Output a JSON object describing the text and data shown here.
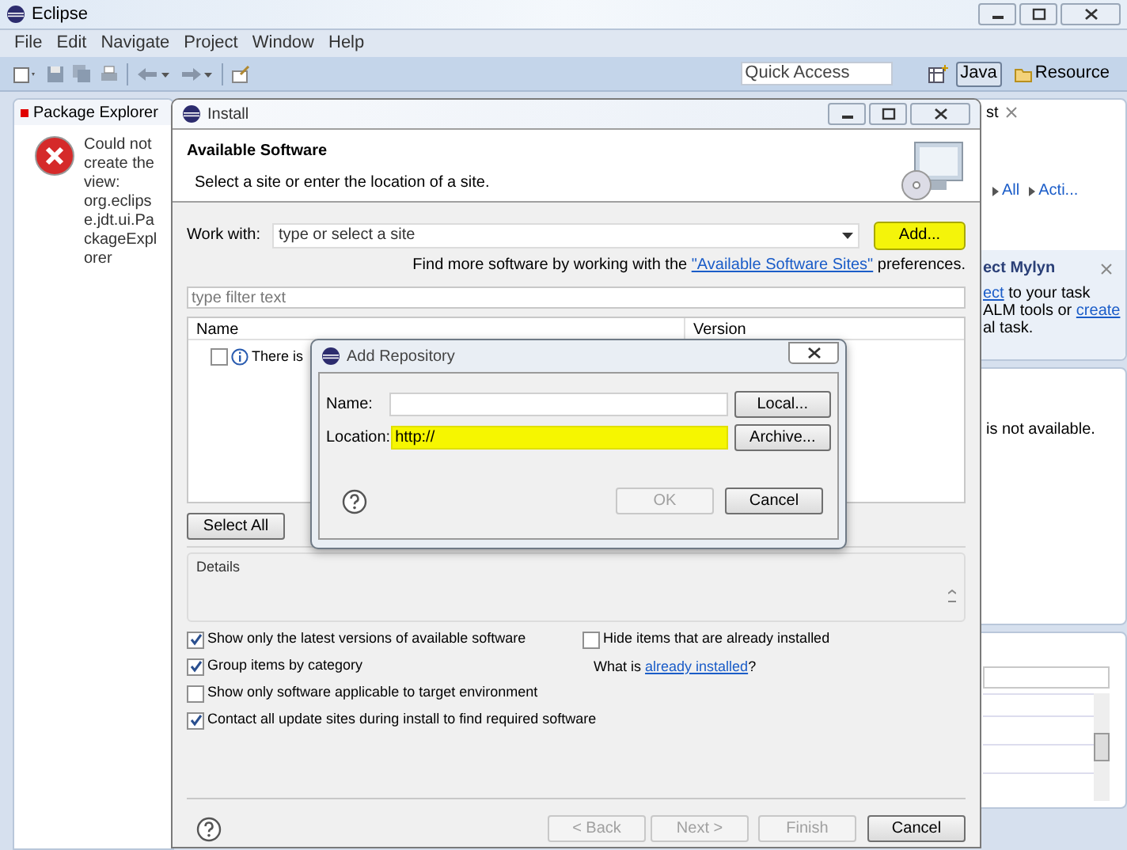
{
  "window": {
    "title": "Eclipse"
  },
  "menu": [
    "File",
    "Edit",
    "Navigate",
    "Project",
    "Window",
    "Help"
  ],
  "quick_access": {
    "placeholder": "Quick Access"
  },
  "perspectives": [
    {
      "label": "Java",
      "selected": true
    },
    {
      "label": "Resource",
      "selected": false
    }
  ],
  "package_explorer": {
    "tab": "Package Explorer",
    "message": "Could not create the view: org.eclipse.jdt.ui.PackageExplorer"
  },
  "task_panel": {
    "tab": "st",
    "links": [
      "All",
      "Acti..."
    ],
    "mylyn_title": "ect Mylyn",
    "mylyn_lines": [
      [
        {
          "text": "ect",
          "kind": "link"
        },
        {
          "text": " to your task",
          "kind": "text"
        }
      ],
      [
        {
          "text": "ALM tools or ",
          "kind": "text"
        },
        {
          "text": "create",
          "kind": "link"
        }
      ],
      [
        {
          "text": "al task.",
          "kind": "text"
        }
      ]
    ]
  },
  "problems_panel": {
    "message": "is not available."
  },
  "install": {
    "title": "Install",
    "heading": "Available Software",
    "subtitle": "Select a site or enter the location of a site.",
    "work_with": {
      "label": "Work with:",
      "placeholder": "type or select a site"
    },
    "add_button": "Add...",
    "hint": {
      "before": "Find more software by working with the ",
      "link": "\"Available Software Sites\"",
      "after": " preferences."
    },
    "filter": {
      "placeholder": "type filter text"
    },
    "table": {
      "columns": [
        "Name",
        "Version"
      ],
      "rows": [
        {
          "name": "There is",
          "checked": false
        }
      ]
    },
    "select_all": "Select All",
    "details": "Details",
    "options_left": [
      {
        "label": "Show only the latest versions of available software",
        "checked": true
      },
      {
        "label": "Group items by category",
        "checked": true
      },
      {
        "label": "Show only software applicable to target environment",
        "checked": false
      },
      {
        "label": "Contact all update sites during install to find required software",
        "checked": true
      }
    ],
    "options_right": [
      {
        "label": "Hide items that are already installed",
        "checked": false
      }
    ],
    "installed_hint": {
      "before": "What is ",
      "link": "already installed",
      "after": "?"
    },
    "buttons": [
      {
        "label": "< Back",
        "disabled": true
      },
      {
        "label": "Next >",
        "disabled": true
      },
      {
        "label": "Finish",
        "disabled": true
      },
      {
        "label": "Cancel",
        "disabled": false
      }
    ]
  },
  "add_repository": {
    "title": "Add Repository",
    "fields": [
      {
        "label": "Name:",
        "button": "Local...",
        "highlighted": false
      },
      {
        "label": "Location:",
        "value": "http://",
        "button": "Archive...",
        "highlighted": true
      }
    ],
    "buttons": [
      {
        "label": "OK",
        "disabled": true
      },
      {
        "label": "Cancel",
        "disabled": false
      }
    ]
  }
}
